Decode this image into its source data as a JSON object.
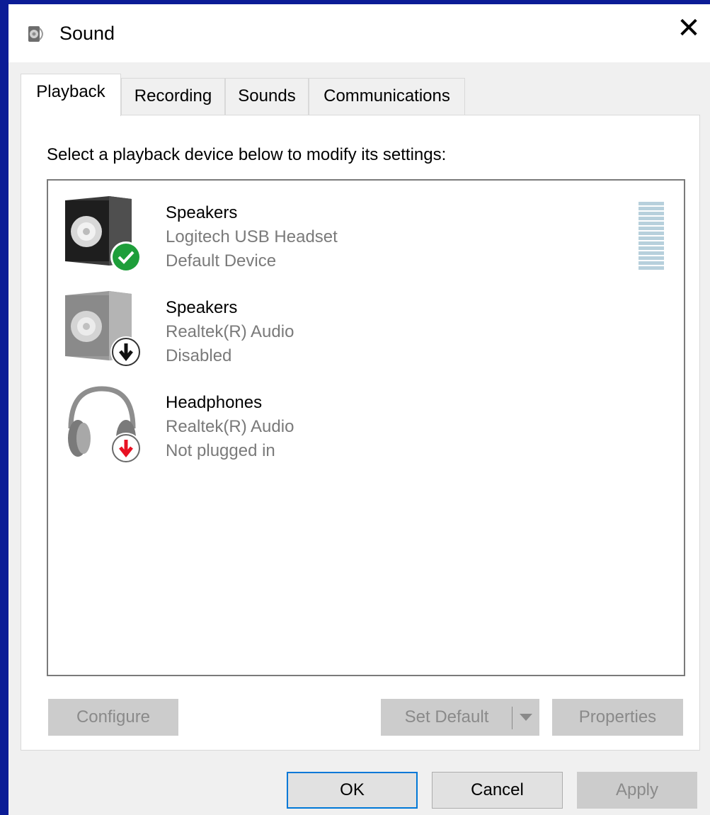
{
  "window": {
    "title": "Sound",
    "close_label": "✕"
  },
  "tabs": [
    {
      "label": "Playback",
      "active": true
    },
    {
      "label": "Recording",
      "active": false
    },
    {
      "label": "Sounds",
      "active": false
    },
    {
      "label": "Communications",
      "active": false
    }
  ],
  "instruction": "Select a playback device below to modify its settings:",
  "devices": [
    {
      "name": "Speakers",
      "description": "Logitech USB Headset",
      "status": "Default Device",
      "icon": "speaker-icon",
      "badge": "green-check-icon"
    },
    {
      "name": "Speakers",
      "description": "Realtek(R) Audio",
      "status": "Disabled",
      "icon": "speaker-icon",
      "badge": "black-down-arrow-icon"
    },
    {
      "name": "Headphones",
      "description": "Realtek(R) Audio",
      "status": "Not plugged in",
      "icon": "headphones-icon",
      "badge": "red-down-arrow-icon"
    }
  ],
  "buttons": {
    "configure": "Configure",
    "set_default": "Set Default",
    "properties": "Properties",
    "ok": "OK",
    "cancel": "Cancel",
    "apply": "Apply"
  },
  "colors": {
    "accent": "#0078d7",
    "check_green": "#1e9e3a",
    "unplugged_red": "#e81123",
    "meter": "#b7d0dc"
  }
}
